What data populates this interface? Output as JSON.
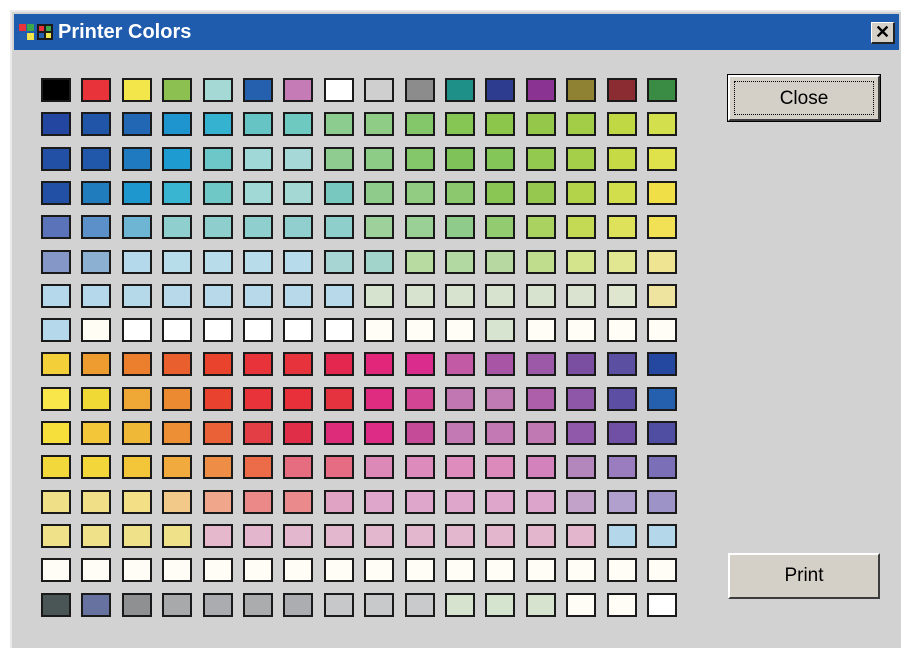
{
  "window": {
    "title": "Printer Colors",
    "close_glyph": "✕"
  },
  "icons": {
    "app": "windows-flag-icon",
    "close": "close-icon"
  },
  "buttons": {
    "close_label": "Close",
    "print_label": "Print"
  },
  "palette": {
    "columns": 16,
    "rows": [
      [
        "#000000",
        "#e8333a",
        "#f3e64a",
        "#8cc152",
        "#a5d9d6",
        "#2460ae",
        "#c47bb6",
        "#ffffff",
        "#cfcfcf",
        "#8c8c8c",
        "#1f9088",
        "#2e3c8f",
        "#8a3393",
        "#8f8232",
        "#8b2c33",
        "#3a8b44"
      ],
      [
        "#2347a1",
        "#2155a8",
        "#2267b3",
        "#1f95cf",
        "#35b2cf",
        "#66c4c5",
        "#6ec9c1",
        "#8dcc8f",
        "#8fcc86",
        "#84c76a",
        "#86c655",
        "#8cc74b",
        "#95c84a",
        "#a3cc47",
        "#bfd844",
        "#d3df4c"
      ],
      [
        "#2150a5",
        "#2158a9",
        "#1f7abf",
        "#1e9bd0",
        "#6dc7c8",
        "#a0d8d8",
        "#a5d8d6",
        "#8ecc90",
        "#8dcc86",
        "#84c76a",
        "#7fc25a",
        "#85c658",
        "#93c94e",
        "#a6cf49",
        "#c5da45",
        "#dfe24a"
      ],
      [
        "#2150a5",
        "#217cbe",
        "#1e97cf",
        "#39b5d1",
        "#6fc7c6",
        "#a1d9d6",
        "#a3d8d4",
        "#78c8c0",
        "#8fcc8c",
        "#92cc83",
        "#8cc86d",
        "#89c653",
        "#96c74e",
        "#b3d34b",
        "#d2de4b",
        "#f1df48"
      ],
      [
        "#5a73b9",
        "#5b90c8",
        "#6db5d3",
        "#8fd0cf",
        "#8ecfcd",
        "#8fcfcd",
        "#90cfcd",
        "#8ecfcb",
        "#9dd09a",
        "#9ad096",
        "#8fcc8b",
        "#93cb71",
        "#a9d260",
        "#c4da55",
        "#dee25b",
        "#f3e155"
      ],
      [
        "#8597c7",
        "#8cb0d1",
        "#b4d9ea",
        "#b7dcea",
        "#b8dcea",
        "#b8dcea",
        "#b7dbea",
        "#a6d5d3",
        "#a3d4cc",
        "#b7dba0",
        "#b3d9a2",
        "#b7d9a1",
        "#c0dc8d",
        "#d3e48c",
        "#e1e690",
        "#efe491"
      ],
      [
        "#b5d8ea",
        "#b5d8ea",
        "#b6d9ea",
        "#b7d9ea",
        "#b7d9ea",
        "#b7d9ea",
        "#b7d9ea",
        "#b7d9ea",
        "#d6e3cf",
        "#d7e3cf",
        "#d7e3cf",
        "#d7e3cf",
        "#d8e3cf",
        "#d9e3cf",
        "#dfe6d0",
        "#efe3a0"
      ],
      [
        "#b5d8ea",
        "#fffdf4",
        "#ffffff",
        "#ffffff",
        "#ffffff",
        "#ffffff",
        "#ffffff",
        "#ffffff",
        "#fffdf6",
        "#fffdf6",
        "#fffdf6",
        "#d7e4cf",
        "#fffdf6",
        "#fffdf6",
        "#fffdf6",
        "#fffdf6"
      ],
      [
        "#f3d03a",
        "#ee9b30",
        "#ec7f2e",
        "#e95f2e",
        "#e9432e",
        "#e8333a",
        "#e7333b",
        "#e3274e",
        "#e2277b",
        "#d92c8d",
        "#c25aa6",
        "#a955a5",
        "#9b59a8",
        "#7a4fa2",
        "#5a4fa1",
        "#2448a0"
      ],
      [
        "#f8e64a",
        "#f1d935",
        "#efa736",
        "#ec8a31",
        "#e9432f",
        "#e8333a",
        "#e73039",
        "#e5343f",
        "#df2b80",
        "#d24594",
        "#c177b1",
        "#c07ab4",
        "#ae5faa",
        "#8f57a7",
        "#5b4ea3",
        "#2460ae"
      ],
      [
        "#f7df3b",
        "#f3c63a",
        "#f0b837",
        "#ec8f35",
        "#ea6138",
        "#e33e45",
        "#e02d48",
        "#dc2c7a",
        "#dc2c86",
        "#c54a98",
        "#c37ab4",
        "#c37ab4",
        "#c079b3",
        "#9059a9",
        "#7050a5",
        "#4f4ea2"
      ],
      [
        "#f2d83a",
        "#f3d63a",
        "#f3c63a",
        "#f1aa3d",
        "#ee8d46",
        "#ec6c4a",
        "#e66c80",
        "#e66c83",
        "#dc89b8",
        "#dc8bbc",
        "#de8cbe",
        "#dc89bb",
        "#d382bb",
        "#b387bc",
        "#9a7dbe",
        "#7b6fb8"
      ],
      [
        "#efe087",
        "#f1df87",
        "#f2df86",
        "#f3c98a",
        "#efa68a",
        "#eb8988",
        "#ea8a8c",
        "#e0a3c4",
        "#dea6cb",
        "#dea6cb",
        "#dea6cb",
        "#dea6cb",
        "#dda4cb",
        "#c2a2c9",
        "#b19fcd",
        "#9e93c7"
      ],
      [
        "#efe08a",
        "#efe08a",
        "#efe08a",
        "#efe08a",
        "#e6b8cc",
        "#e3b6cd",
        "#e3b7cd",
        "#e3b7cd",
        "#e3b7cd",
        "#e3b7cd",
        "#e3b7cd",
        "#e3b6cd",
        "#e3b6cd",
        "#e3b6cd",
        "#b4d8ea",
        "#b4d8ea"
      ],
      [
        "#fffdf6",
        "#fffdf6",
        "#fffdf6",
        "#fffdf6",
        "#fffdf6",
        "#fffdf6",
        "#fffdf6",
        "#fffdf6",
        "#fffdf6",
        "#fffdf6",
        "#fffdf6",
        "#fffdf6",
        "#fffdf6",
        "#fffdf6",
        "#fffdf6",
        "#fffdf6"
      ],
      [
        "#4a5656",
        "#6872a1",
        "#8e9091",
        "#a7a9ab",
        "#aaacaf",
        "#aaacae",
        "#abadb0",
        "#c6c8c9",
        "#c8c9cb",
        "#c9cacb",
        "#d6e3cf",
        "#d5e4cf",
        "#d6e3cf",
        "#fffdf6",
        "#fffdf6",
        "#ffffff"
      ]
    ]
  }
}
